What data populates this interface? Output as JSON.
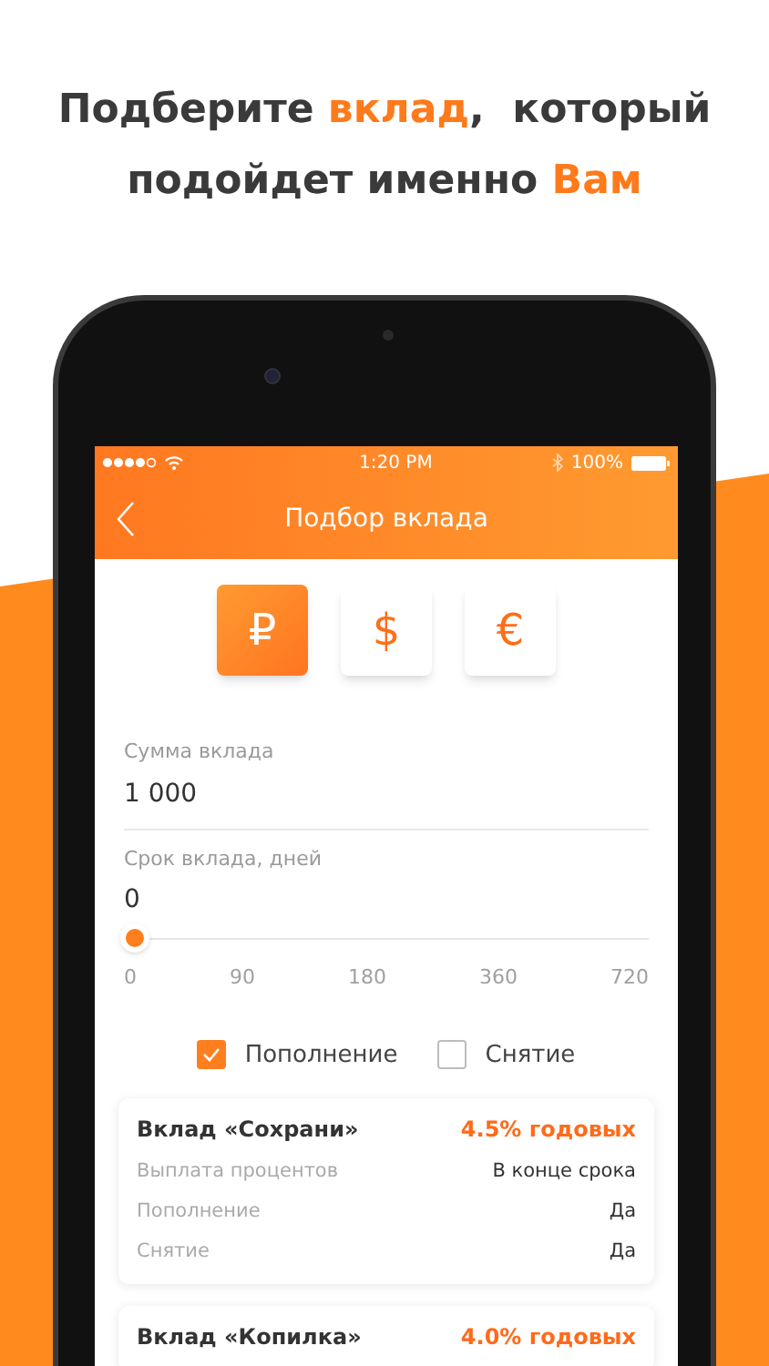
{
  "headline": [
    [
      {
        "text": "Подберите ",
        "accent": false
      },
      {
        "text": "вклад",
        "accent": true
      },
      {
        "text": ",  который",
        "accent": false
      }
    ],
    [
      {
        "text": "подойдет именно ",
        "accent": false
      },
      {
        "text": "Вам",
        "accent": true
      }
    ]
  ],
  "status_bar": {
    "time": "1:20 PM",
    "battery": "100%"
  },
  "nav": {
    "title": "Подбор вклада"
  },
  "currencies": [
    {
      "symbol": "₽",
      "selected": true
    },
    {
      "symbol": "$",
      "selected": false
    },
    {
      "symbol": "€",
      "selected": false
    }
  ],
  "amount": {
    "label": "Сумма вклада",
    "value": "1 000"
  },
  "term": {
    "label": "Срок вклада, дней",
    "value": "0",
    "level": 0,
    "ticks": [
      "0",
      "90",
      "180",
      "360",
      "720"
    ]
  },
  "options": [
    {
      "label": "Пополнение",
      "checked": true
    },
    {
      "label": "Снятие",
      "checked": false
    }
  ],
  "deposits": [
    {
      "title": "Вклад «Сохрани»",
      "rate": "4.5% годовых",
      "rows": [
        {
          "label": "Выплата процентов",
          "value": "В конце срока"
        },
        {
          "label": "Пополнение",
          "value": "Да"
        },
        {
          "label": "Снятие",
          "value": "Да"
        }
      ]
    },
    {
      "title": "Вклад «Копилка»",
      "rate": "4.0% годовых"
    }
  ]
}
